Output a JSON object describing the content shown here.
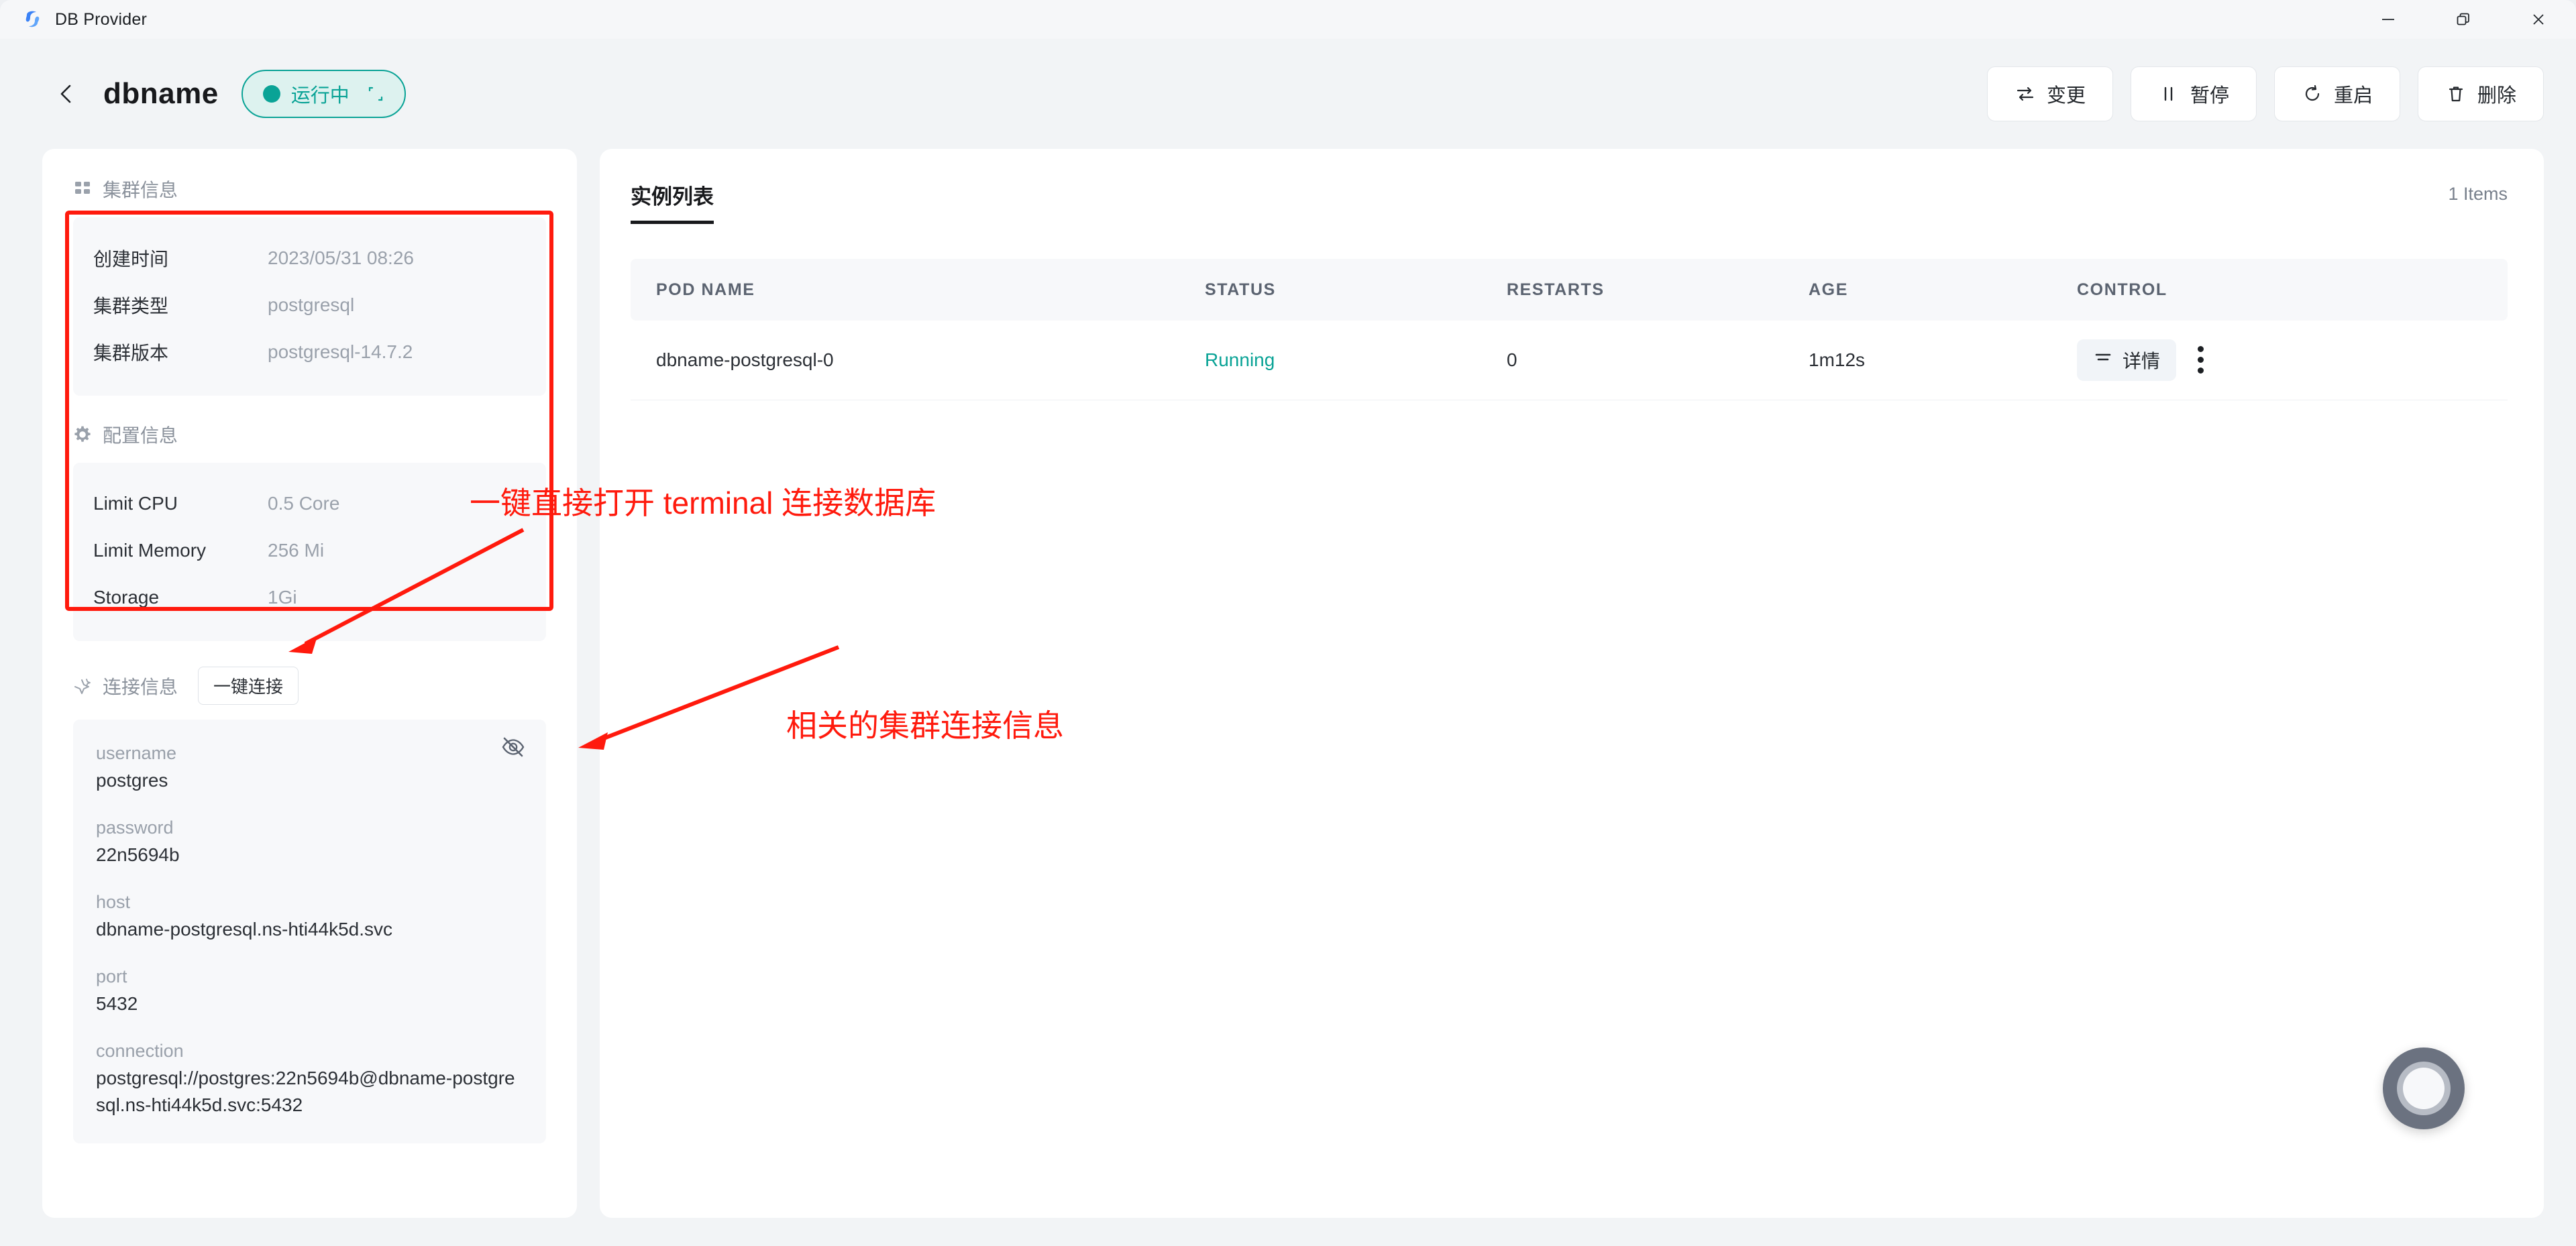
{
  "window": {
    "app_title": "DB Provider",
    "logo_icon": "db-provider-logo",
    "minimize_icon": "minimize-icon",
    "maximize_icon": "restore-icon",
    "close_icon": "close-icon"
  },
  "header": {
    "back_icon": "chevron-left-icon",
    "title": "dbname",
    "status": {
      "label": "运行中",
      "dot_color": "#0aa396",
      "text_color": "#0aa396",
      "bg_color": "#ddf2ef",
      "expand_icon": "expand-icon"
    },
    "actions": [
      {
        "label": "变更",
        "icon": "change-arrows-icon"
      },
      {
        "label": "暂停",
        "icon": "pause-icon"
      },
      {
        "label": "重启",
        "icon": "restart-icon"
      },
      {
        "label": "删除",
        "icon": "trash-icon"
      }
    ]
  },
  "sidebar": {
    "cluster_section": {
      "icon": "grid-icon",
      "title": "集群信息",
      "rows": [
        {
          "key": "创建时间",
          "value": "2023/05/31 08:26"
        },
        {
          "key": "集群类型",
          "value": "postgresql"
        },
        {
          "key": "集群版本",
          "value": "postgresql-14.7.2"
        }
      ]
    },
    "config_section": {
      "icon": "gear-icon",
      "title": "配置信息",
      "rows": [
        {
          "key": "Limit CPU",
          "value": "0.5 Core"
        },
        {
          "key": "Limit Memory",
          "value": "256 Mi"
        },
        {
          "key": "Storage",
          "value": "1Gi"
        }
      ]
    },
    "connection_section": {
      "icon": "link-sparkle-icon",
      "title": "连接信息",
      "button_label": "一键连接",
      "toggle_icon": "eye-off-icon",
      "items": [
        {
          "label": "username",
          "value": "postgres"
        },
        {
          "label": "password",
          "value": "22n5694b"
        },
        {
          "label": "host",
          "value": "dbname-postgresql.ns-hti44k5d.svc"
        },
        {
          "label": "port",
          "value": "5432"
        },
        {
          "label": "connection",
          "value": "postgresql://postgres:22n5694b@dbname-postgresql.ns-hti44k5d.svc:5432"
        }
      ]
    }
  },
  "main": {
    "tab_label": "实例列表",
    "items_count": "1 Items",
    "table": {
      "columns": [
        "POD NAME",
        "STATUS",
        "RESTARTS",
        "AGE",
        "CONTROL"
      ],
      "rows": [
        {
          "pod_name": "dbname-postgresql-0",
          "status": "Running",
          "restarts": "0",
          "age": "1m12s",
          "detail_label": "详情",
          "detail_icon": "list-icon",
          "more_icon": "kebab-menu-icon"
        }
      ]
    },
    "float_button_icon": "ring-button-icon"
  },
  "annotations": {
    "color": "#ff1a0d",
    "terminal_note": "一键直接打开 terminal 连接数据库",
    "connection_note": "相关的集群连接信息"
  }
}
